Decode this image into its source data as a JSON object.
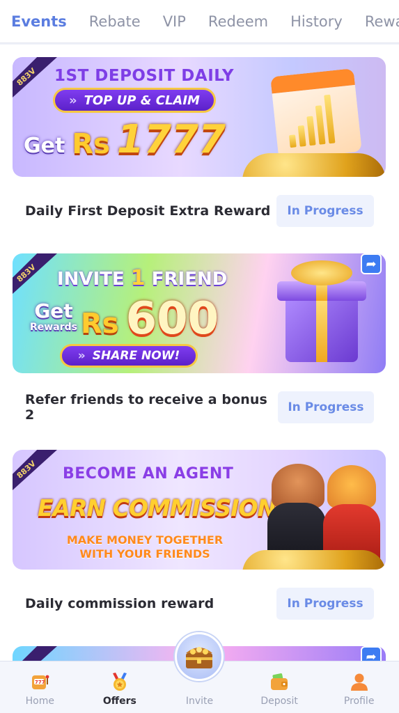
{
  "tabs": [
    "Events",
    "Rebate",
    "VIP",
    "Redeem",
    "History",
    "Reward"
  ],
  "banner_badge": "883V",
  "cards": [
    {
      "banner": {
        "title": "1ST DEPOSIT DAILY",
        "button": "TOP UP & CLAIM",
        "get": "Get",
        "currency": "Rs",
        "amount": "1777"
      },
      "description": "Daily First Deposit Extra Reward",
      "status": "In Progress"
    },
    {
      "banner": {
        "title_a": "INVITE",
        "title_num": "1",
        "title_b": "FRIEND",
        "get": "Get",
        "get_sub": "Rewards",
        "currency": "Rs",
        "amount": "600",
        "button": "SHARE NOW!"
      },
      "description": "Refer friends to receive a bonus 2",
      "status": "In Progress"
    },
    {
      "banner": {
        "title": "BECOME AN AGENT",
        "headline": "EARN COMMISSION",
        "sub_1": "MAKE MONEY TOGETHER",
        "sub_2": "WITH YOUR FRIENDS"
      },
      "description": "Daily commission reward",
      "status": "In Progress"
    }
  ],
  "nav": [
    {
      "label": "Home",
      "icon": "slot-machine-icon"
    },
    {
      "label": "Offers",
      "icon": "medal-icon"
    },
    {
      "label": "Invite",
      "icon": "treasure-chest-icon"
    },
    {
      "label": "Deposit",
      "icon": "wallet-icon"
    },
    {
      "label": "Profile",
      "icon": "user-icon"
    }
  ],
  "colors": {
    "accent": "#5b7de0",
    "status_bg": "#eef2fd",
    "status_text": "#6a8be6"
  }
}
